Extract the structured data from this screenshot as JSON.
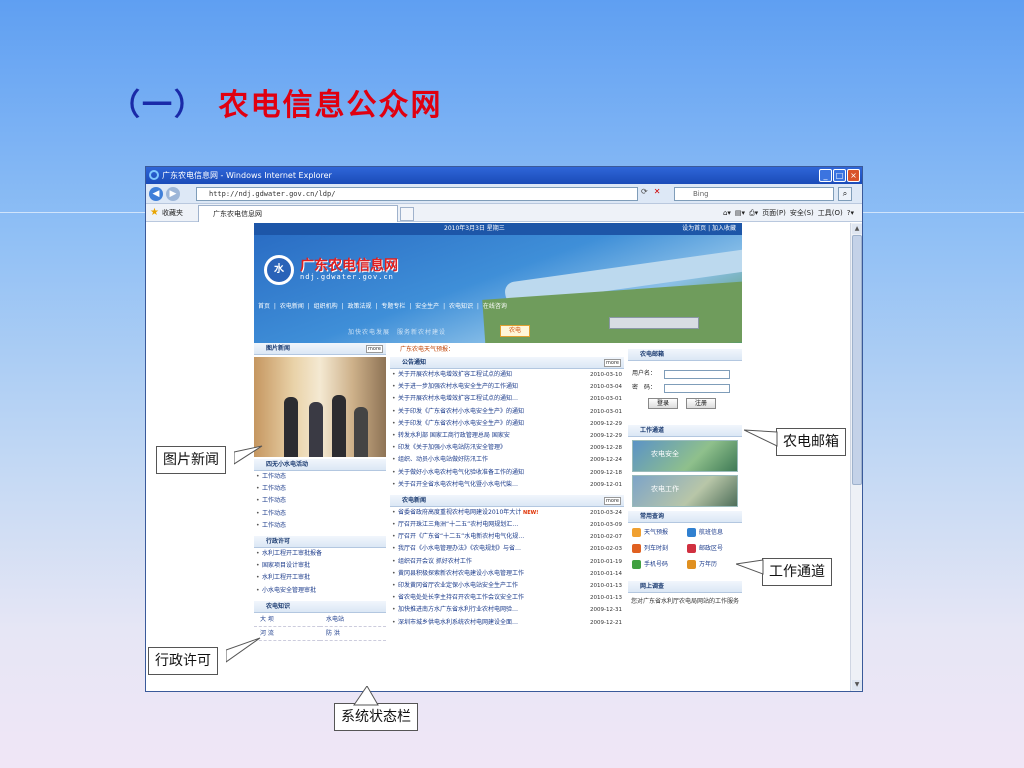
{
  "slide": {
    "title_num": "（一）",
    "title_text": "农电信息公众网"
  },
  "browser": {
    "window_title": "广东农电信息网 - Windows Internet Explorer",
    "url": "http://ndj.gdwater.gov.cn/ldp/",
    "search_placeholder": "Bing",
    "favorites_label": "收藏夹",
    "tab_title": "广东农电信息网",
    "cmd_page": "页面(P)",
    "cmd_safety": "安全(S)",
    "cmd_tools": "工具(O)"
  },
  "site": {
    "top_date": "2010年3月3日 星期三",
    "top_links": "设为首页 | 加入收藏",
    "logo_text": "广东农电信息网",
    "logo_url": "ndj.gdwater.gov.cn",
    "nav": "首页 | 农电新闻 | 组织机构 | 政策法规 | 专题专栏 | 安全生产 | 农电知识 | 在线咨询",
    "slogan": "加快农电发展　服务新农村建设",
    "slogan_badge": "农电",
    "weather_bar": "广东农电天气预报："
  },
  "left": {
    "photo_news_title": "图片新闻",
    "more": "more",
    "hydro_title": "四无小水电活动",
    "hydro_items": [
      "工作动态",
      "工作动态",
      "工作动态",
      "工作动态",
      "工作动态"
    ],
    "permit_title": "行政许可",
    "permit_items": [
      "水利工程开工审批报备",
      "国家项目设计审批",
      "水利工程开工审批",
      "小水电安全管理审批"
    ],
    "knowledge_title": "农电知识",
    "knowledge_items": [
      "大 坝",
      "水电站",
      "河 流",
      "防 洪"
    ]
  },
  "mid": {
    "notice_title": "公告通知",
    "notices": [
      {
        "t": "关于开展农村水电增效扩容工程试点的通知",
        "d": "2010-03-10"
      },
      {
        "t": "关于进一步加强农村水电安全生产的工作通知",
        "d": "2010-03-04"
      },
      {
        "t": "关于开展农村水电增效扩容工程试点的通知…",
        "d": "2010-03-01"
      },
      {
        "t": "关于印发《广东省农村小水电安全生产》的通知",
        "d": "2010-03-01"
      },
      {
        "t": "关于印发《广东省农村小水电安全生产》的通知",
        "d": "2009-12-29"
      },
      {
        "t": "转发水利部 国家工商行政管理总局 国家安",
        "d": "2009-12-29"
      },
      {
        "t": "印发《关于加强小水电站防汛安全管理》",
        "d": "2009-12-28"
      },
      {
        "t": "组织、动员小水电站做好防汛工作",
        "d": "2009-12-24"
      },
      {
        "t": "关于做好小水电农村电气化验收准备工作的通知",
        "d": "2009-12-18"
      },
      {
        "t": "关于召开全省水电农村电气化暨小水电代柴…",
        "d": "2009-12-01"
      }
    ],
    "news_title": "农电新闻",
    "news": [
      {
        "t": "省委省政府高度重视农村电网建设2010年大计",
        "d": "2010-03-24",
        "new": "NEW!"
      },
      {
        "t": "厅召开珠江三角洲“十二五”农村电网规划汇…",
        "d": "2010-03-09",
        "new": ""
      },
      {
        "t": "厅召开《广东省“十二五”水电新农村电气化规…",
        "d": "2010-02-07",
        "new": ""
      },
      {
        "t": "我厅召《小水电管理办法》《农电规划》与省…",
        "d": "2010-02-03",
        "new": ""
      },
      {
        "t": "组织召开会议 抓好农村工作",
        "d": "2010-01-19",
        "new": ""
      },
      {
        "t": "黄冈县积极探索新农村农电建设小水电管理工作",
        "d": "2010-01-14",
        "new": ""
      },
      {
        "t": "印发黄冈省厅农业定保小水电站安全生产工作",
        "d": "2010-01-13",
        "new": ""
      },
      {
        "t": "省农电处处长李主持召开农电工作会议安全工作",
        "d": "2010-01-13",
        "new": ""
      },
      {
        "t": "加快推进南方水广东省水利行业农村电网验…",
        "d": "2009-12-31",
        "new": ""
      },
      {
        "t": "深圳市城乡供电水利系统农村电网建设全面…",
        "d": "2009-12-21",
        "new": ""
      }
    ]
  },
  "right": {
    "mail_title": "农电邮箱",
    "user_label": "用户名：",
    "pass_label": "密　码：",
    "login_btn": "登录",
    "register_btn": "注册",
    "work_title": "工作通道",
    "work_img1": "农电安全",
    "work_img2": "农电工作",
    "common_title": "常用查询",
    "tools": [
      "天气预报",
      "航班信息",
      "列车时刻",
      "邮政区号",
      "手机号码",
      "万年历"
    ],
    "survey_title": "网上调查",
    "survey_text": "您对广东省水利厅农电局网站的工作服务"
  },
  "callouts": {
    "photo_news": "图片新闻",
    "permit": "行政许可",
    "mail": "农电邮箱",
    "work": "工作通道",
    "statusbar": "系统状态栏"
  },
  "colors": {
    "title_red": "#e00010",
    "title_blue": "#1a2aa8",
    "site_blue": "#1d56a8"
  }
}
